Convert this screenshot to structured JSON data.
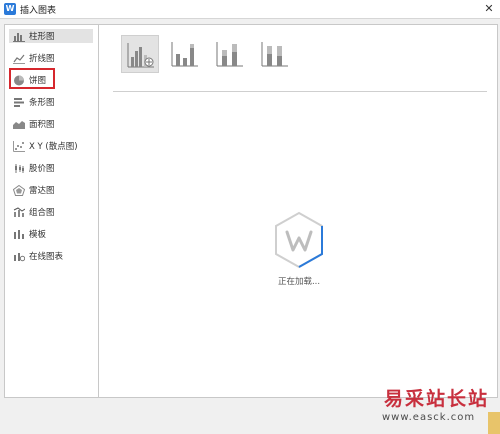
{
  "window": {
    "title": "插入图表",
    "close_glyph": "✕"
  },
  "sidebar": {
    "items": [
      {
        "label": "柱形图",
        "icon": "column-chart-icon"
      },
      {
        "label": "折线图",
        "icon": "line-chart-icon"
      },
      {
        "label": "饼图",
        "icon": "pie-chart-icon"
      },
      {
        "label": "条形图",
        "icon": "bar-chart-icon"
      },
      {
        "label": "面积图",
        "icon": "area-chart-icon"
      },
      {
        "label": "X Y (散点图)",
        "icon": "scatter-chart-icon"
      },
      {
        "label": "股价图",
        "icon": "stock-chart-icon"
      },
      {
        "label": "雷达图",
        "icon": "radar-chart-icon"
      },
      {
        "label": "组合图",
        "icon": "combo-chart-icon"
      },
      {
        "label": "模板",
        "icon": "template-icon"
      },
      {
        "label": "在线图表",
        "icon": "online-chart-icon"
      }
    ],
    "selected": "柱形图",
    "highlighted": "饼图"
  },
  "subtypes": [
    {
      "name": "clustered-column",
      "selected": true
    },
    {
      "name": "stacked-column",
      "selected": false
    },
    {
      "name": "percent-stacked-column",
      "selected": false
    },
    {
      "name": "3d-column",
      "selected": false
    }
  ],
  "loading": {
    "text": "正在加载..."
  },
  "watermark": {
    "brand": "易采站长站",
    "url": "www.easck.com"
  },
  "colors": {
    "accent": "#2b7ad9",
    "highlight": "#d6272d",
    "watermark": "#c8303e"
  }
}
